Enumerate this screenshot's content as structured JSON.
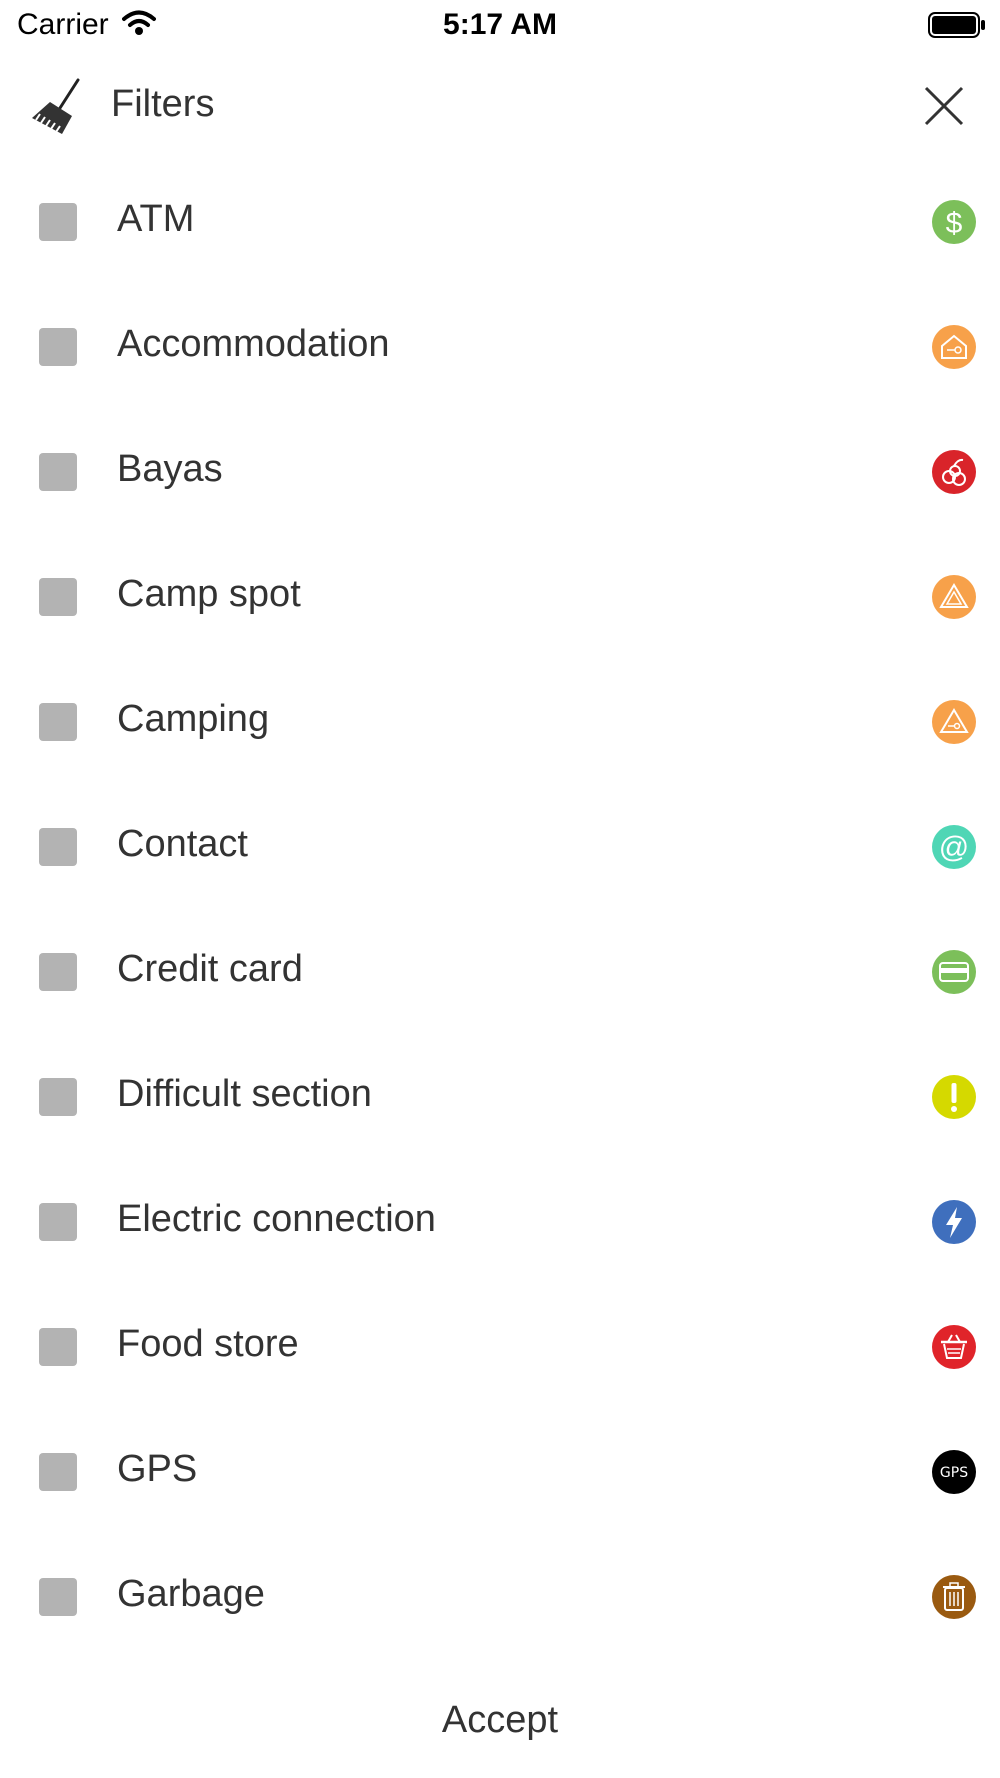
{
  "status_bar": {
    "carrier": "Carrier",
    "time": "5:17 AM"
  },
  "header": {
    "title": "Filters"
  },
  "items": [
    {
      "label": "ATM",
      "icon": "dollar-icon",
      "color": "#7cbf5a"
    },
    {
      "label": "Accommodation",
      "icon": "house-key-icon",
      "color": "#f7a14a"
    },
    {
      "label": "Bayas",
      "icon": "berries-icon",
      "color": "#d9242a"
    },
    {
      "label": "Camp spot",
      "icon": "tent-icon",
      "color": "#f7a14a"
    },
    {
      "label": "Camping",
      "icon": "tent-key-icon",
      "color": "#f7a14a"
    },
    {
      "label": "Contact",
      "icon": "at-sign-icon",
      "color": "#4fd6b5"
    },
    {
      "label": "Credit card",
      "icon": "credit-card-icon",
      "color": "#7cbf5a"
    },
    {
      "label": "Difficult section",
      "icon": "exclamation-icon",
      "color": "#d5d900"
    },
    {
      "label": "Electric connection",
      "icon": "lightning-icon",
      "color": "#3f6fbd"
    },
    {
      "label": "Food store",
      "icon": "basket-icon",
      "color": "#e0242a"
    },
    {
      "label": "GPS",
      "icon": "gps-icon",
      "color": "#000000",
      "icon_text": "GPS"
    },
    {
      "label": "Garbage",
      "icon": "trash-icon",
      "color": "#9a5a10"
    }
  ],
  "footer": {
    "accept_label": "Accept"
  }
}
